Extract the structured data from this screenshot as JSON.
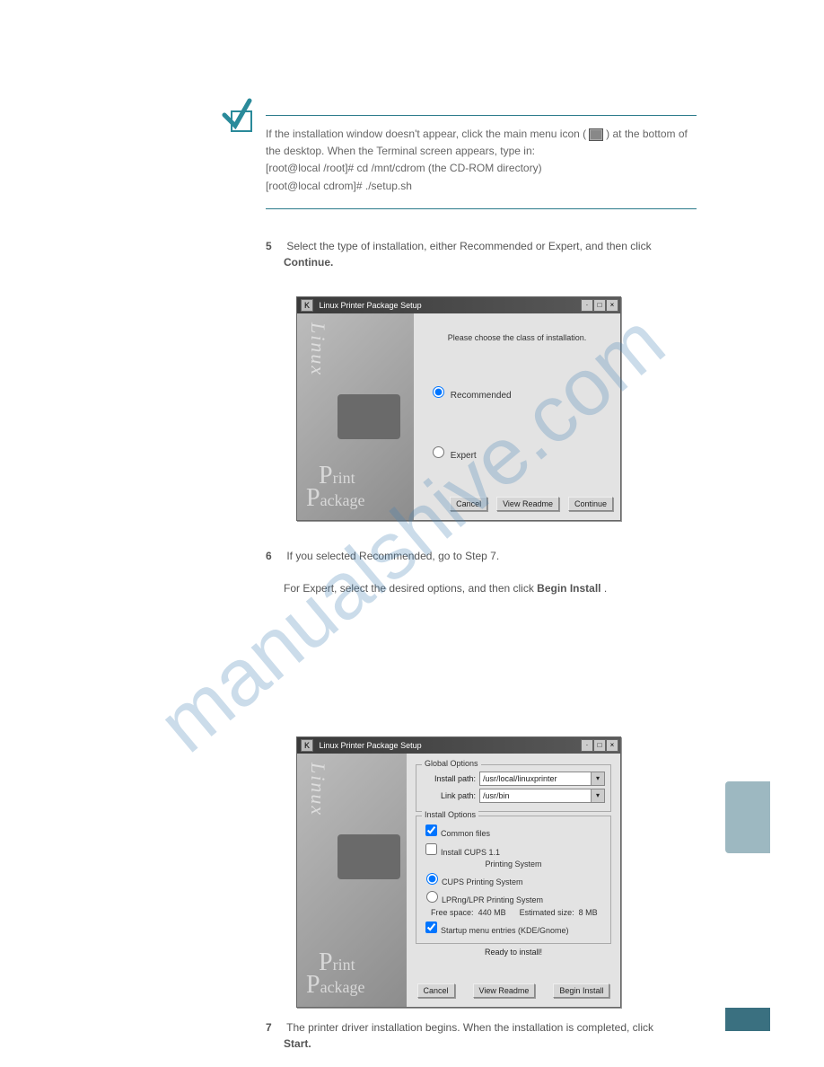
{
  "watermark": "manualshive.com",
  "note": {
    "line1_prefix": "If the installation window doesn't appear, click the main menu icon (",
    "line1_suffix": ") at the bottom of the desktop. When the Terminal screen appears, type in:",
    "line2": "[root@local /root]# cd /mnt/cdrom (the CD-ROM directory)",
    "line3": "[root@local cdrom]# ./setup.sh"
  },
  "steps": {
    "s5_num": "5",
    "s5a": "Select the type of installation, either Recommended or Expert, and then click",
    "s5b": "Continue.",
    "s6_num": "6",
    "s6a": "If you selected Recommended, go to Step 7.",
    "s6b_prefix": "For Expert, select the desired options, and then click ",
    "s6b_bold": "Begin Install",
    "s6b_suffix": ".",
    "s7_num": "7",
    "s7a": "The printer driver installation begins. When the installation is completed, click",
    "s7b": "Start."
  },
  "dialog1": {
    "title": "Linux Printer Package Setup",
    "instruction": "Please choose the class of installation.",
    "radio_recommended": "Recommended",
    "radio_expert": "Expert",
    "btn_cancel": "Cancel",
    "btn_view": "View Readme",
    "btn_continue": "Continue"
  },
  "dialog2": {
    "title": "Linux Printer Package Setup",
    "global_title": "Global Options",
    "install_path_label": "Install path:",
    "install_path_value": "/usr/local/linuxprinter",
    "link_path_label": "Link path:",
    "link_path_value": "/usr/bin",
    "install_options_title": "Install Options",
    "chk_common": "Common files",
    "chk_cups": "Install CUPS 1.1",
    "printing_system_heading": "Printing System",
    "radio_cups": "CUPS Printing System",
    "radio_lpr": "LPRng/LPR Printing System",
    "free_space_label": "Free space:",
    "free_space_value": "440 MB",
    "est_size_label": "Estimated size:",
    "est_size_value": "8 MB",
    "chk_startup": "Startup menu entries (KDE/Gnome)",
    "ready": "Ready to install!",
    "btn_cancel": "Cancel",
    "btn_view": "View Readme",
    "btn_begin": "Begin Install"
  },
  "sidepanel": {
    "linux": "Linux",
    "print": "rint",
    "package": "ackage",
    "P": "P"
  }
}
